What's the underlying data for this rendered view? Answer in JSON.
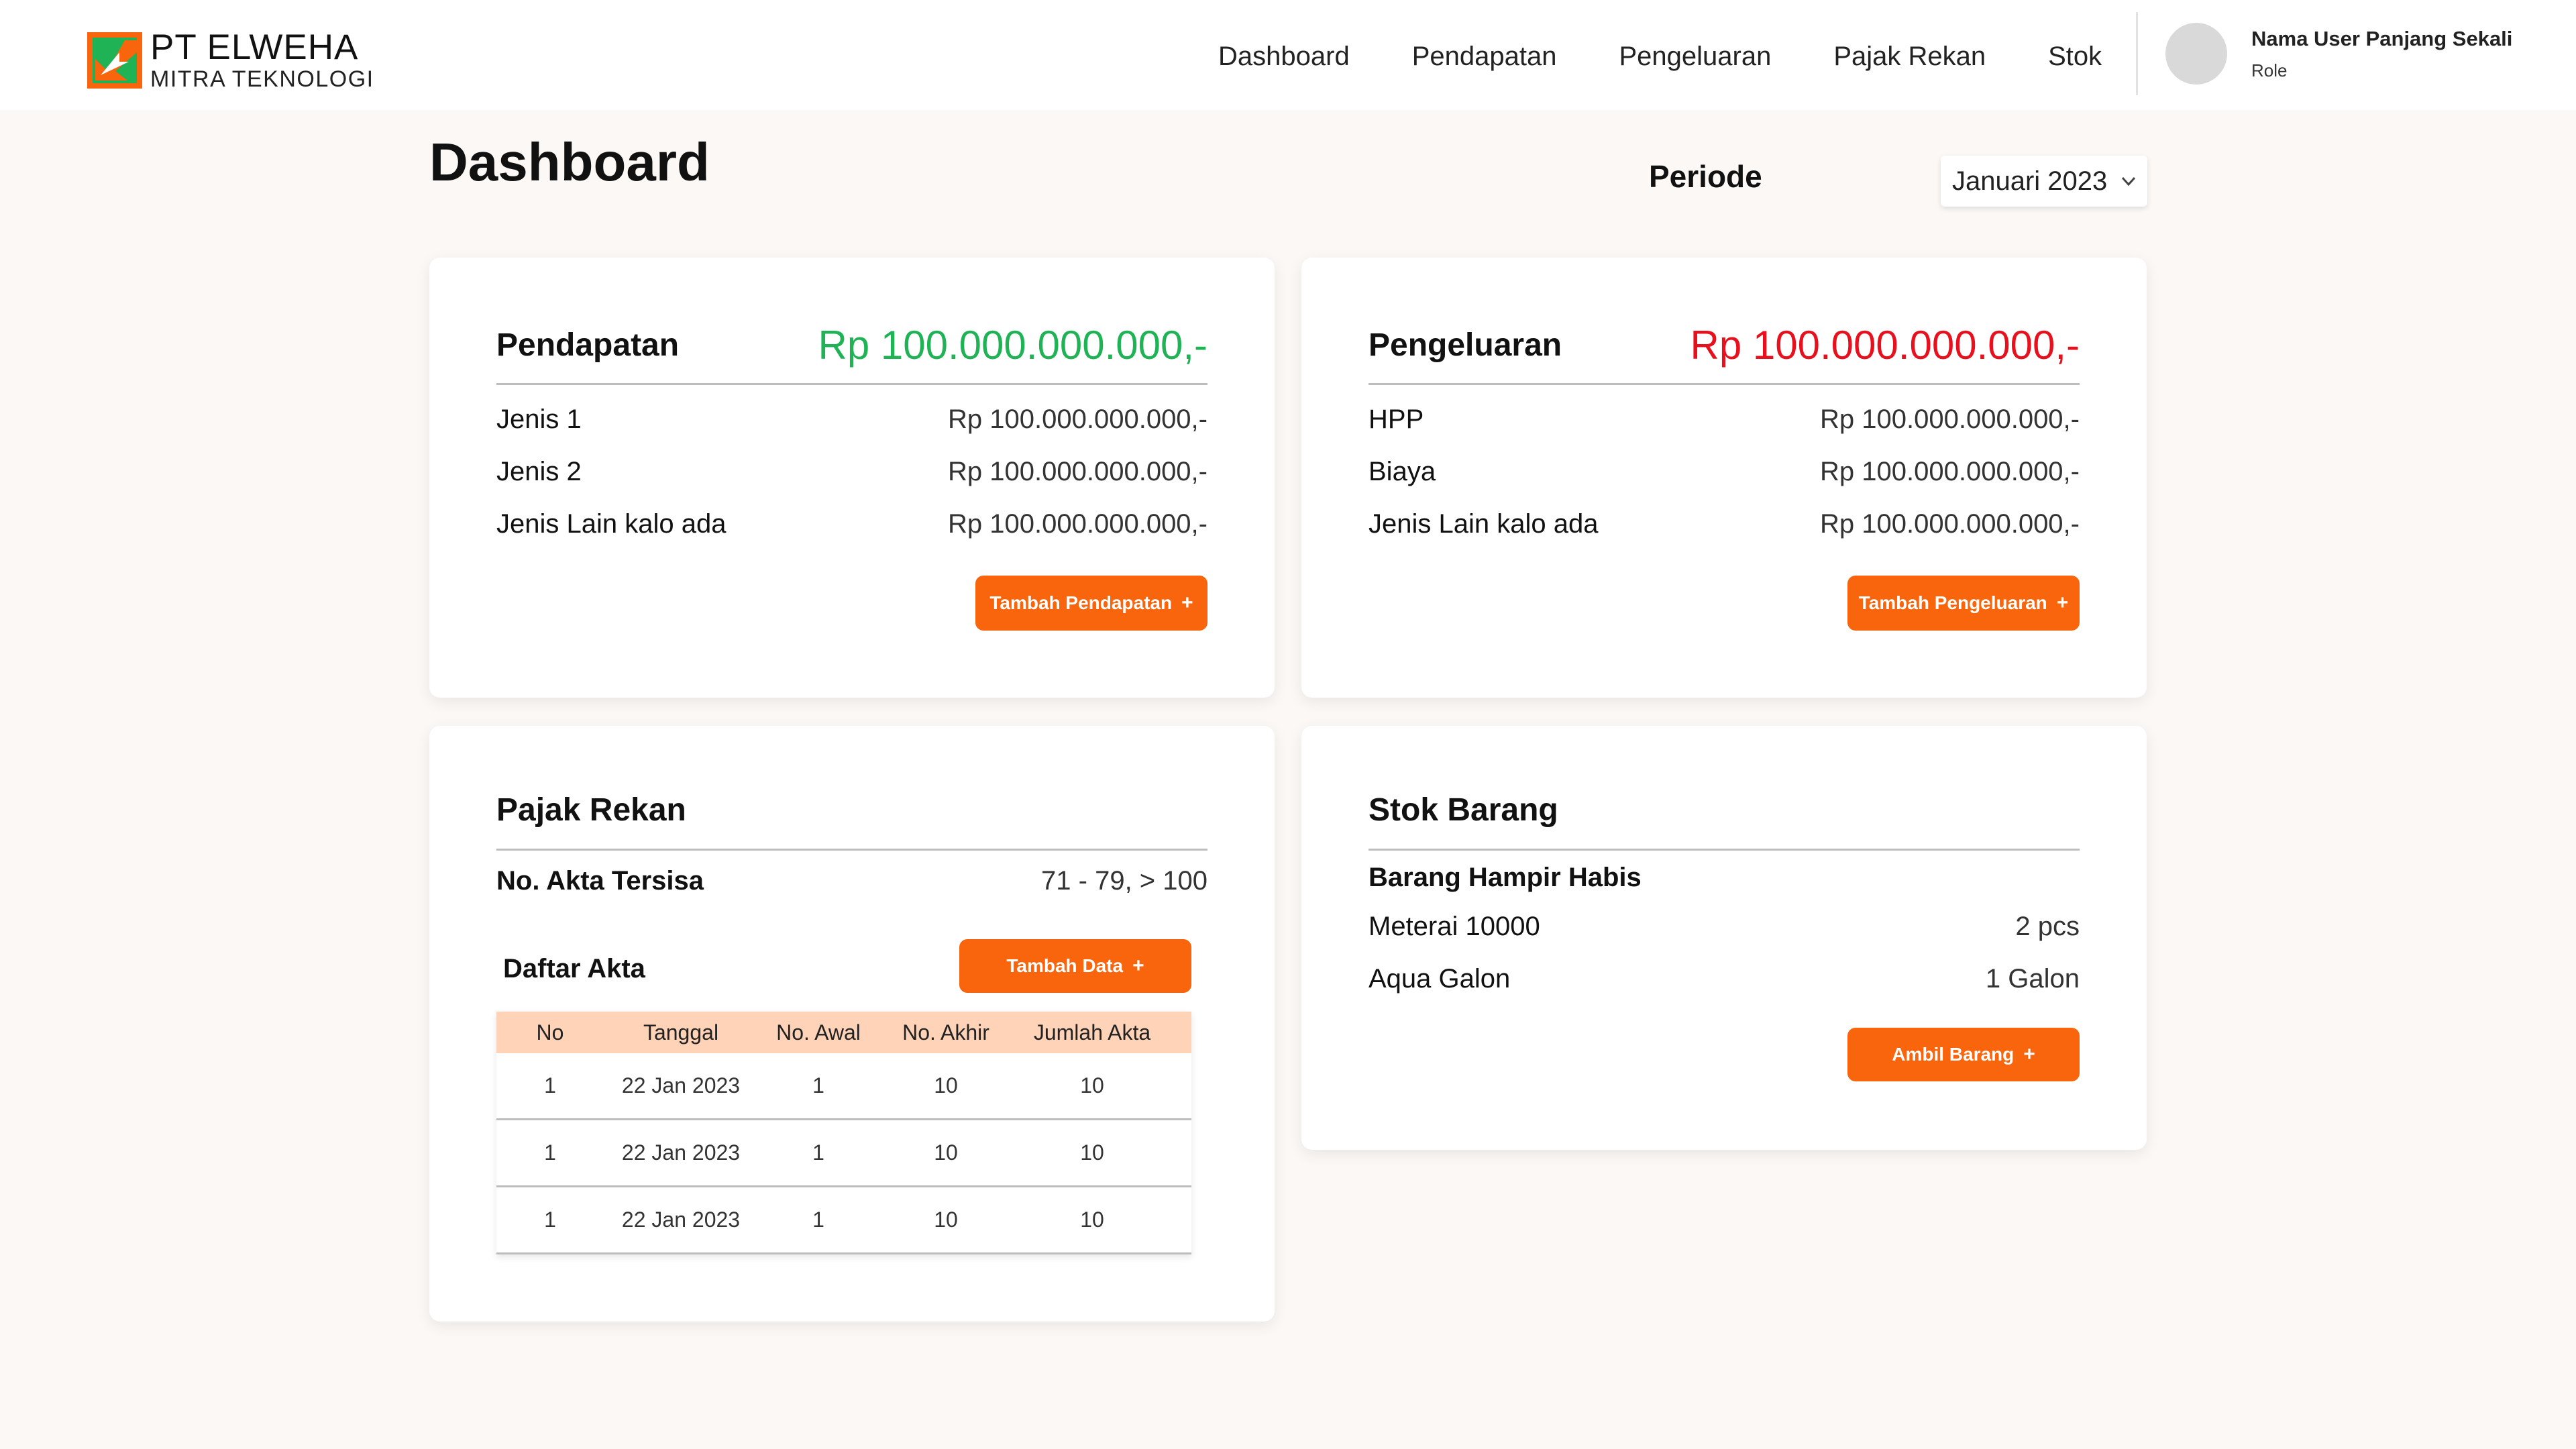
{
  "app": {
    "logo_title": "PT ELWEHA",
    "logo_subtitle": "MITRA TEKNOLOGI"
  },
  "nav": {
    "items": [
      "Dashboard",
      "Pendapatan",
      "Pengeluaran",
      "Pajak Rekan",
      "Stok"
    ]
  },
  "user": {
    "name": "Nama User Panjang Sekali",
    "role": "Role"
  },
  "page": {
    "title": "Dashboard",
    "periode_label": "Periode",
    "periode_value": "Januari 2023"
  },
  "pendapatan": {
    "title": "Pendapatan",
    "total": "Rp 100.000.000.000,-",
    "rows": [
      {
        "label": "Jenis 1",
        "value": "Rp 100.000.000.000,-"
      },
      {
        "label": "Jenis 2",
        "value": "Rp 100.000.000.000,-"
      },
      {
        "label": "Jenis Lain kalo ada",
        "value": "Rp 100.000.000.000,-"
      }
    ],
    "button": "Tambah Pendapatan"
  },
  "pengeluaran": {
    "title": "Pengeluaran",
    "total": "Rp 100.000.000.000,-",
    "rows": [
      {
        "label": "HPP",
        "value": "Rp 100.000.000.000,-"
      },
      {
        "label": "Biaya",
        "value": "Rp 100.000.000.000,-"
      },
      {
        "label": "Jenis Lain kalo ada",
        "value": "Rp 100.000.000.000,-"
      }
    ],
    "button": "Tambah Pengeluaran"
  },
  "pajak": {
    "title": "Pajak Rekan",
    "akta_label": "No. Akta Tersisa",
    "akta_value": "71 - 79, > 100",
    "daftar_title": "Daftar Akta",
    "button": "Tambah Data",
    "columns": [
      "No",
      "Tanggal",
      "No. Awal",
      "No. Akhir",
      "Jumlah Akta"
    ],
    "rows": [
      {
        "no": "1",
        "tanggal": "22 Jan 2023",
        "awal": "1",
        "akhir": "10",
        "jumlah": "10"
      },
      {
        "no": "1",
        "tanggal": "22 Jan 2023",
        "awal": "1",
        "akhir": "10",
        "jumlah": "10"
      },
      {
        "no": "1",
        "tanggal": "22 Jan 2023",
        "awal": "1",
        "akhir": "10",
        "jumlah": "10"
      }
    ]
  },
  "stok": {
    "title": "Stok Barang",
    "subtitle": "Barang Hampir Habis",
    "rows": [
      {
        "label": "Meterai 10000",
        "value": "2 pcs"
      },
      {
        "label": "Aqua Galon",
        "value": "1 Galon"
      }
    ],
    "button": "Ambil Barang"
  },
  "icons": {
    "logo": "logo-mark-icon",
    "periode_dropdown": "chevron-down-icon",
    "plus": "plus-icon"
  },
  "colors": {
    "accent": "#f8650c",
    "income": "#1fb356",
    "expense": "#e8101d",
    "table_header": "#ffd3b8"
  }
}
